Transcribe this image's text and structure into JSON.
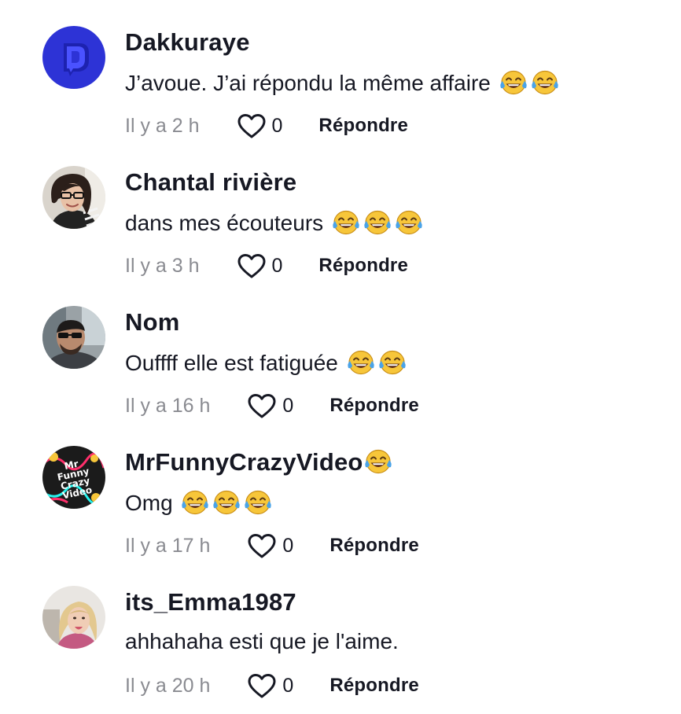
{
  "comments": [
    {
      "username": "Dakkuraye",
      "text": "J’avoue. J’ai répondu la même affaire",
      "emoji_count": 2,
      "name_emoji": 0,
      "time": "Il y a 2 h",
      "likes": "0",
      "reply_label": "Répondre",
      "avatar": "blue-logo"
    },
    {
      "username": "Chantal rivière",
      "text": "dans mes écouteurs",
      "emoji_count": 3,
      "name_emoji": 0,
      "time": "Il y a 3 h",
      "likes": "0",
      "reply_label": "Répondre",
      "avatar": "woman-glasses"
    },
    {
      "username": "Nom",
      "text": "Ouffff elle est fatiguée",
      "emoji_count": 2,
      "name_emoji": 0,
      "time": "Il y a 16 h",
      "likes": "0",
      "reply_label": "Répondre",
      "avatar": "man-car"
    },
    {
      "username": "MrFunnyCrazyVideo",
      "text": "Omg",
      "emoji_count": 3,
      "name_emoji": 1,
      "time": "Il y a 17 h",
      "likes": "0",
      "reply_label": "Répondre",
      "avatar": "funny-logo",
      "avatar_text": [
        "Mr",
        "Funny",
        "Crazy",
        "Video"
      ]
    },
    {
      "username": "its_Emma1987",
      "text": "ahhahaha esti que je l'aime.",
      "emoji_count": 0,
      "name_emoji": 0,
      "time": "Il y a 20 h",
      "likes": "0",
      "reply_label": "Répondre",
      "avatar": "woman-blonde"
    }
  ],
  "emoji_name": "face-with-tears-of-joy",
  "colors": {
    "text": "#161823",
    "muted": "#8a8b91",
    "avatar_blue": "#2d33d6"
  }
}
